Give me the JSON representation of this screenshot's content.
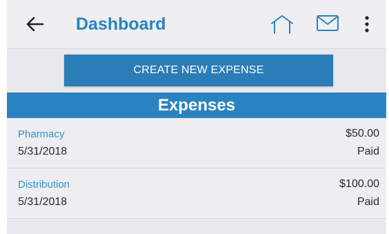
{
  "header": {
    "back_icon": "arrow-left-icon",
    "title": "Dashboard",
    "home_icon": "home-icon",
    "mail_icon": "envelope-icon",
    "more_icon": "more-vert-icon"
  },
  "create_button_label": "CREATE NEW EXPENSE",
  "section_title": "Expenses",
  "expenses": [
    {
      "name": "Pharmacy",
      "date": "5/31/2018",
      "amount": "$50.00",
      "status": "Paid"
    },
    {
      "name": "Distribution",
      "date": "5/31/2018",
      "amount": "$100.00",
      "status": "Paid"
    }
  ],
  "colors": {
    "accent": "#2784c0",
    "button": "#2b7db8",
    "link": "#2f93cf",
    "background": "#e9e8ec"
  }
}
